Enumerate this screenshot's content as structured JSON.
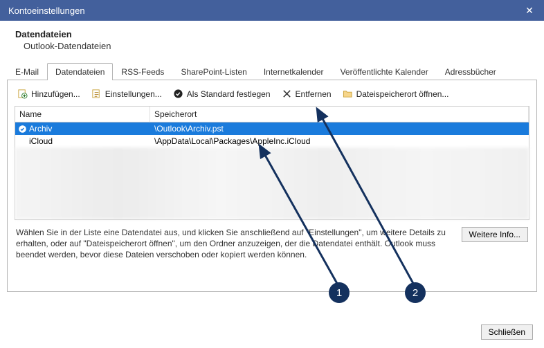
{
  "titlebar": {
    "title": "Kontoeinstellungen"
  },
  "heading": {
    "title": "Datendateien",
    "subtitle": "Outlook-Datendateien"
  },
  "tabs": [
    {
      "label": "E-Mail"
    },
    {
      "label": "Datendateien"
    },
    {
      "label": "RSS-Feeds"
    },
    {
      "label": "SharePoint-Listen"
    },
    {
      "label": "Internetkalender"
    },
    {
      "label": "Veröffentlichte Kalender"
    },
    {
      "label": "Adressbücher"
    }
  ],
  "toolbar": {
    "add": "Hinzufügen...",
    "settings": "Einstellungen...",
    "default": "Als Standard festlegen",
    "remove": "Entfernen",
    "openloc": "Dateispeicherort öffnen..."
  },
  "table": {
    "headers": {
      "name": "Name",
      "location": "Speicherort"
    },
    "rows": [
      {
        "name": "Archiv",
        "location": "\\Outlook\\Archiv.pst",
        "selected": true,
        "default": true
      },
      {
        "name": "iCloud",
        "location": "\\AppData\\Local\\Packages\\AppleInc.iCloud",
        "selected": false,
        "default": false
      }
    ]
  },
  "description": "Wählen Sie in der Liste eine Datendatei aus, und klicken Sie anschließend auf \"Einstellungen\", um weitere Details zu erhalten, oder auf \"Dateispeicherort öffnen\", um den Ordner anzuzeigen, der die Datendatei enthält. Outlook muss beendet werden, bevor diese Dateien verschoben oder kopiert werden können.",
  "buttons": {
    "moreinfo": "Weitere Info...",
    "close": "Schließen"
  },
  "callouts": {
    "1": "1",
    "2": "2"
  }
}
